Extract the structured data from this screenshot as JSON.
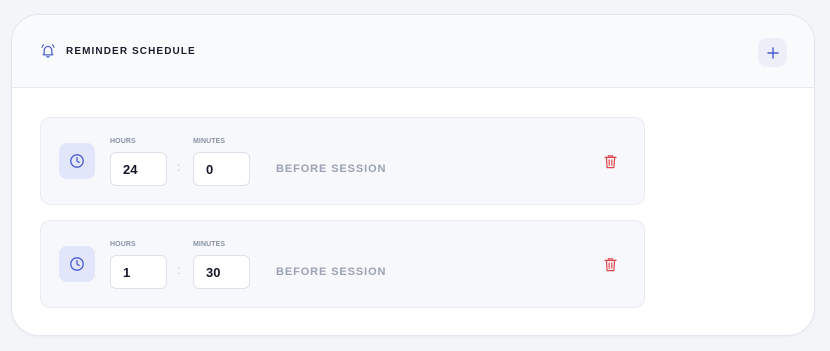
{
  "header": {
    "title": "REMINDER SCHEDULE",
    "icon": "bell-icon",
    "add_icon": "plus-icon"
  },
  "colors": {
    "accent": "#4a5bd4",
    "danger": "#e0474c",
    "muted_text": "#9aa2b3"
  },
  "reminders": [
    {
      "hours_label": "HOURS",
      "hours_value": "24",
      "minutes_label": "MINUTES",
      "minutes_value": "0",
      "separator": ":",
      "suffix": "BEFORE SESSION"
    },
    {
      "hours_label": "HOURS",
      "hours_value": "1",
      "minutes_label": "MINUTES",
      "minutes_value": "30",
      "separator": ":",
      "suffix": "BEFORE SESSION"
    }
  ]
}
